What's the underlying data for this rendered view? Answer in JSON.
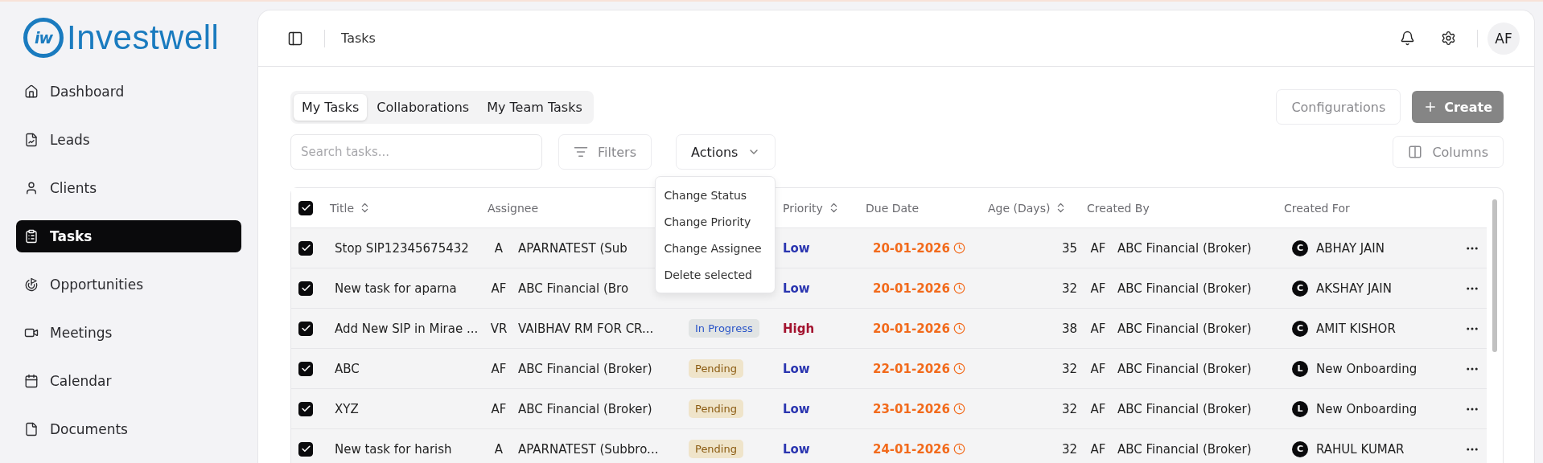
{
  "logo": {
    "mark": "iw",
    "name": "Investwell"
  },
  "sidebar": {
    "items": [
      {
        "label": "Dashboard",
        "selected": false
      },
      {
        "label": "Leads",
        "selected": false
      },
      {
        "label": "Clients",
        "selected": false
      },
      {
        "label": "Tasks",
        "selected": true
      },
      {
        "label": "Opportunities",
        "selected": false
      },
      {
        "label": "Meetings",
        "selected": false
      },
      {
        "label": "Calendar",
        "selected": false
      },
      {
        "label": "Documents",
        "selected": false
      }
    ]
  },
  "header": {
    "breadcrumb": "Tasks",
    "avatar": "AF"
  },
  "tabs": [
    {
      "label": "My Tasks",
      "selected": true
    },
    {
      "label": "Collaborations",
      "selected": false
    },
    {
      "label": "My Team Tasks",
      "selected": false
    }
  ],
  "buttons": {
    "configurations": "Configurations",
    "create": "Create",
    "filters": "Filters",
    "actions": "Actions",
    "columns": "Columns"
  },
  "search": {
    "placeholder": "Search tasks..."
  },
  "actions_menu": [
    "Change Status",
    "Change Priority",
    "Change Assignee",
    "Delete selected"
  ],
  "table": {
    "all_checked": true,
    "columns": [
      {
        "label": "Title",
        "sortable": true
      },
      {
        "label": "Assignee",
        "sortable": false
      },
      {
        "label": "Priority",
        "sortable": true
      },
      {
        "label": "Due Date",
        "sortable": false
      },
      {
        "label": "Age (Days)",
        "sortable": true
      },
      {
        "label": "Created By",
        "sortable": false
      },
      {
        "label": "Created For",
        "sortable": false
      }
    ],
    "rows": [
      {
        "checked": true,
        "title": "Stop SIP12345675432",
        "assignee_initials": "A",
        "assignee": "APARNATEST (Sub",
        "priority": {
          "text": "Low",
          "color": "#2a35b0"
        },
        "due": "20-01-2026",
        "overdue": true,
        "age": "35",
        "creator_initials": "AF",
        "creator": "ABC Financial (Broker)",
        "for_badge": "C",
        "for": "ABHAY JAIN"
      },
      {
        "checked": true,
        "title": "New task for aparna",
        "assignee_initials": "AF",
        "assignee": "ABC Financial (Bro",
        "priority": {
          "text": "Low",
          "color": "#2a35b0"
        },
        "due": "20-01-2026",
        "overdue": true,
        "age": "32",
        "creator_initials": "AF",
        "creator": "ABC Financial (Broker)",
        "for_badge": "C",
        "for": "AKSHAY JAIN"
      },
      {
        "checked": true,
        "title": "Add New SIP in Mirae ...",
        "assignee_initials": "VR",
        "assignee": "VAIBHAV RM FOR CR...",
        "status": {
          "text": "In Progress",
          "color": "#2a55c8"
        },
        "priority": {
          "text": "High",
          "color": "#a3132f"
        },
        "due": "20-01-2026",
        "overdue": true,
        "age": "38",
        "creator_initials": "AF",
        "creator": "ABC Financial (Broker)",
        "for_badge": "C",
        "for": "AMIT KISHOR"
      },
      {
        "checked": true,
        "title": "ABC",
        "assignee_initials": "AF",
        "assignee": "ABC Financial (Broker)",
        "status": {
          "text": "Pending",
          "color": "#8a5a10"
        },
        "priority": {
          "text": "Low",
          "color": "#2a35b0"
        },
        "due": "22-01-2026",
        "overdue": true,
        "age": "32",
        "creator_initials": "AF",
        "creator": "ABC Financial (Broker)",
        "for_badge": "L",
        "for": "New Onboarding"
      },
      {
        "checked": true,
        "title": "XYZ",
        "assignee_initials": "AF",
        "assignee": "ABC Financial (Broker)",
        "status": {
          "text": "Pending",
          "color": "#8a5a10"
        },
        "priority": {
          "text": "Low",
          "color": "#2a35b0"
        },
        "due": "23-01-2026",
        "overdue": true,
        "age": "32",
        "creator_initials": "AF",
        "creator": "ABC Financial (Broker)",
        "for_badge": "L",
        "for": "New Onboarding"
      },
      {
        "checked": true,
        "title": "New task for harish",
        "assignee_initials": "A",
        "assignee": "APARNATEST (Subbro...",
        "status": {
          "text": "Pending",
          "color": "#8a5a10"
        },
        "priority": {
          "text": "Low",
          "color": "#2a35b0"
        },
        "due": "24-01-2026",
        "overdue": true,
        "age": "32",
        "creator_initials": "AF",
        "creator": "ABC Financial (Broker)",
        "for_badge": "C",
        "for": "RAHUL KUMAR"
      }
    ]
  }
}
